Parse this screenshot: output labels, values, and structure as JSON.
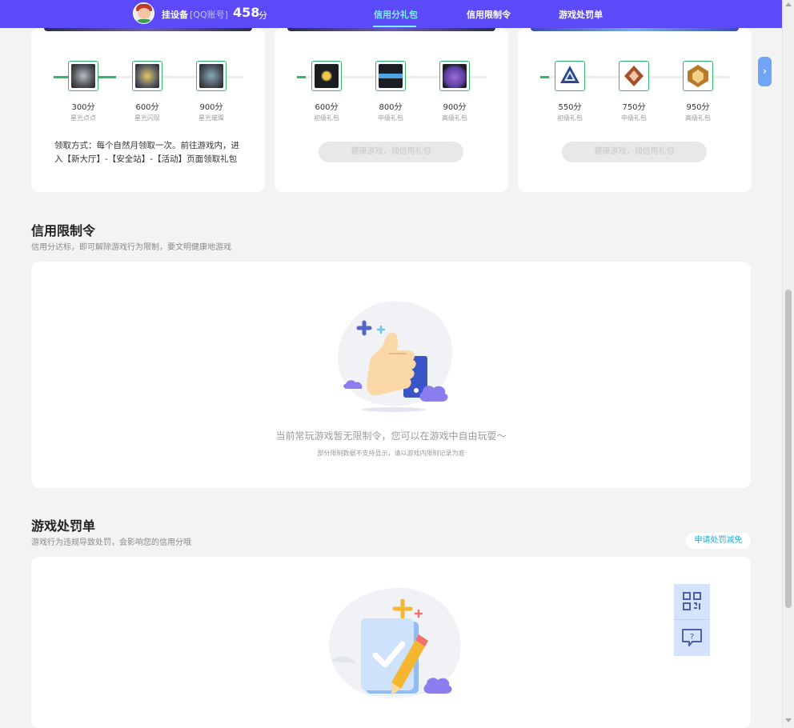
{
  "header": {
    "user_name": "挂设备",
    "account_type": "[QQ账号]",
    "score": "458",
    "score_unit": "分",
    "nav": [
      {
        "label": "信用分礼包",
        "active": true
      },
      {
        "label": "信用限制令",
        "active": false
      },
      {
        "label": "游戏处罚单",
        "active": false
      }
    ]
  },
  "gift_cards": [
    {
      "items": [
        {
          "points": "300分",
          "name": "星光点点"
        },
        {
          "points": "600分",
          "name": "星光闪现"
        },
        {
          "points": "900分",
          "name": "星光璀璨"
        }
      ],
      "claim_text": "领取方式：每个自然月领取一次。前往游戏内，进入【新大厅】-【安全站】-【活动】页面领取礼包"
    },
    {
      "items": [
        {
          "points": "600分",
          "name": "初级礼包"
        },
        {
          "points": "800分",
          "name": "中级礼包"
        },
        {
          "points": "900分",
          "name": "高级礼包"
        }
      ],
      "button_label": "健康游戏，领信用礼包"
    },
    {
      "items": [
        {
          "points": "550分",
          "name": "初级礼包"
        },
        {
          "points": "750分",
          "name": "中级礼包"
        },
        {
          "points": "950分",
          "name": "高级礼包"
        }
      ],
      "button_label": "健康游戏，领信用礼包"
    }
  ],
  "restriction": {
    "title": "信用限制令",
    "subtitle": "信用分达标，即可解除游戏行为限制，要文明健康地游戏",
    "empty_message": "当前常玩游戏暂无限制令，您可以在游戏中自由玩耍～",
    "empty_note": "部分限制数据不支持显示，请以游戏内限制记录为准"
  },
  "penalty": {
    "title": "游戏处罚单",
    "subtitle": "游戏行为违规导致处罚，会影响您的信用分哦",
    "apply_label": "申请处罚减免"
  },
  "colors": {
    "brand": "#5a4af8",
    "nav_active": "#7ff0ff",
    "progress": "#2fb866",
    "link": "#21a8d8"
  }
}
